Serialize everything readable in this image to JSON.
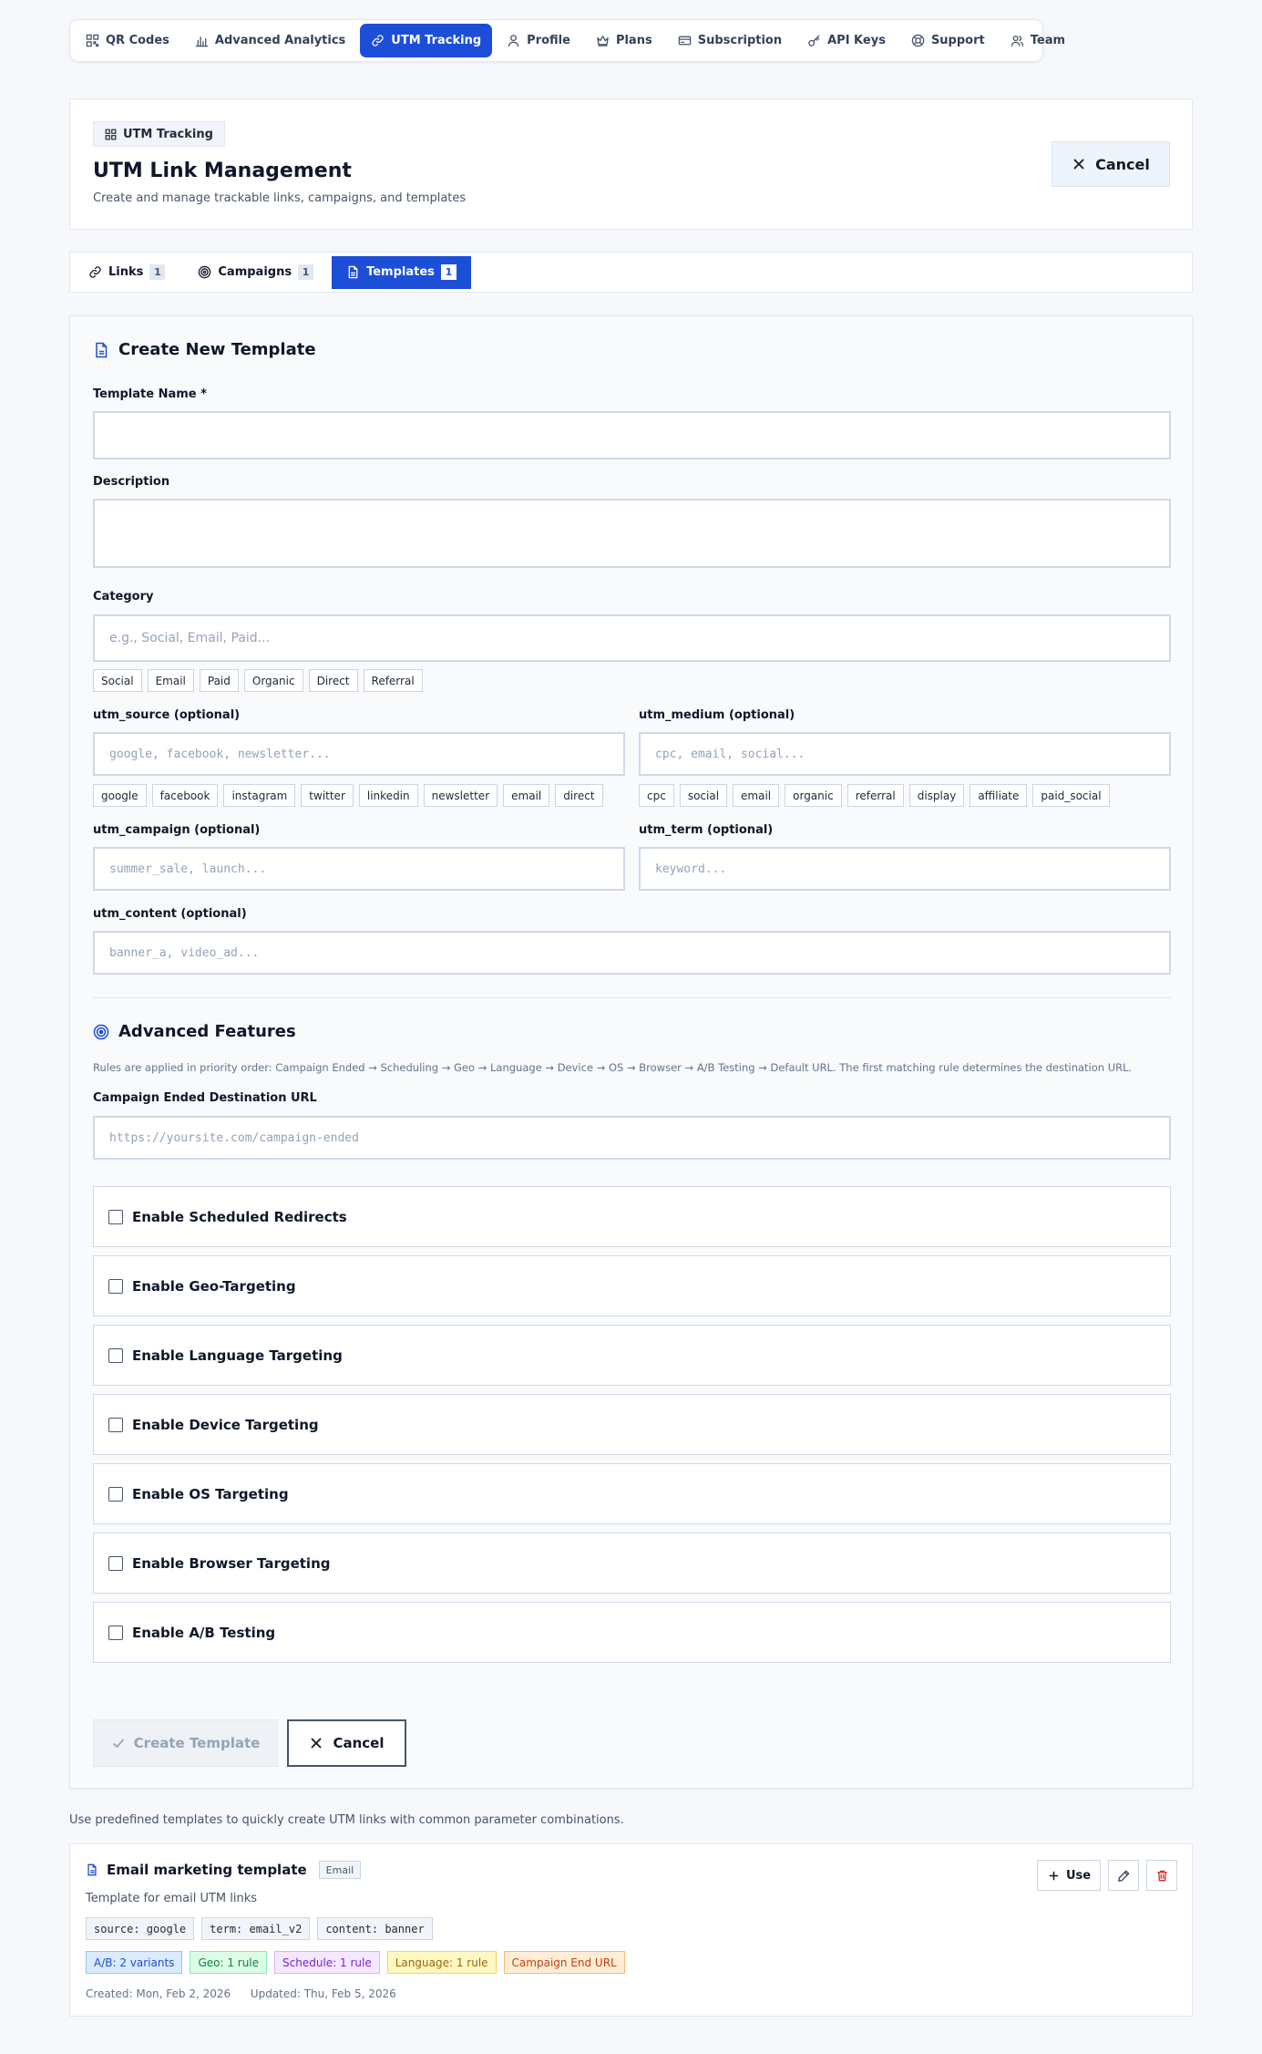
{
  "nav": [
    {
      "label": "QR Codes",
      "icon": "qr-code-icon",
      "active": false
    },
    {
      "label": "Advanced Analytics",
      "icon": "bar-chart-icon",
      "active": false
    },
    {
      "label": "UTM Tracking",
      "icon": "link-icon",
      "active": true
    },
    {
      "label": "Profile",
      "icon": "user-icon",
      "active": false
    },
    {
      "label": "Plans",
      "icon": "crown-icon",
      "active": false
    },
    {
      "label": "Subscription",
      "icon": "credit-card-icon",
      "active": false
    },
    {
      "label": "API Keys",
      "icon": "key-icon",
      "active": false
    },
    {
      "label": "Support",
      "icon": "lifebuoy-icon",
      "active": false
    },
    {
      "label": "Team",
      "icon": "users-icon",
      "active": false
    }
  ],
  "header": {
    "chip": "UTM Tracking",
    "title": "UTM Link Management",
    "subtitle": "Create and manage trackable links, campaigns, and templates",
    "cancel": "Cancel"
  },
  "tabs": [
    {
      "label": "Links",
      "count": "1",
      "icon": "link-icon",
      "active": false
    },
    {
      "label": "Campaigns",
      "count": "1",
      "icon": "target-icon",
      "active": false
    },
    {
      "label": "Templates",
      "count": "1",
      "icon": "file-icon",
      "active": true
    }
  ],
  "form": {
    "title": "Create New Template",
    "name_label": "Template Name *",
    "name_value": "",
    "description_label": "Description",
    "description_value": "",
    "category_label": "Category",
    "category_placeholder": "e.g., Social, Email, Paid...",
    "category_options": [
      "Social",
      "Email",
      "Paid",
      "Organic",
      "Direct",
      "Referral"
    ],
    "source_label": "utm_source (optional)",
    "source_placeholder": "google, facebook, newsletter...",
    "source_options": [
      "google",
      "facebook",
      "instagram",
      "twitter",
      "linkedin",
      "newsletter",
      "email",
      "direct"
    ],
    "medium_label": "utm_medium (optional)",
    "medium_placeholder": "cpc, email, social...",
    "medium_options": [
      "cpc",
      "social",
      "email",
      "organic",
      "referral",
      "display",
      "affiliate",
      "paid_social"
    ],
    "campaign_label": "utm_campaign (optional)",
    "campaign_placeholder": "summer_sale, launch...",
    "term_label": "utm_term (optional)",
    "term_placeholder": "keyword...",
    "content_label": "utm_content (optional)",
    "content_placeholder": "banner_a, video_ad...",
    "advanced_title": "Advanced Features",
    "advanced_note": "Rules are applied in priority order: Campaign Ended → Scheduling → Geo → Language → Device → OS → Browser → A/B Testing → Default URL. The first matching rule determines the destination URL.",
    "ended_label": "Campaign Ended Destination URL",
    "ended_placeholder": "https://yoursite.com/campaign-ended",
    "features": [
      {
        "label": "Enable Scheduled Redirects",
        "checked": false
      },
      {
        "label": "Enable Geo-Targeting",
        "checked": false
      },
      {
        "label": "Enable Language Targeting",
        "checked": false
      },
      {
        "label": "Enable Device Targeting",
        "checked": false
      },
      {
        "label": "Enable OS Targeting",
        "checked": false
      },
      {
        "label": "Enable Browser Targeting",
        "checked": false
      },
      {
        "label": "Enable A/B Testing",
        "checked": false
      }
    ],
    "create_button": "Create Template",
    "cancel_button": "Cancel"
  },
  "info_text": "Use predefined templates to quickly create UTM links with common parameter combinations.",
  "template": {
    "name": "Email marketing template",
    "category": "Email",
    "description": "Template for email UTM links",
    "params": [
      "source: google",
      "term: email_v2",
      "content: banner"
    ],
    "badges": [
      {
        "label": "A/B: 2 variants",
        "bg": "#dbeafe",
        "border": "#93c5fd",
        "color": "#1d4ed8"
      },
      {
        "label": "Geo: 1 rule",
        "bg": "#dcfce7",
        "border": "#86efac",
        "color": "#15803d"
      },
      {
        "label": "Schedule: 1 rule",
        "bg": "#f3e8ff",
        "border": "#d8b4fe",
        "color": "#7e22ce"
      },
      {
        "label": "Language: 1 rule",
        "bg": "#fef9c3",
        "border": "#fcd34d",
        "color": "#a16207"
      },
      {
        "label": "Campaign End URL",
        "bg": "#ffedd5",
        "border": "#fdba74",
        "color": "#c2410c"
      }
    ],
    "created": "Created: Mon, Feb 2, 2026",
    "updated": "Updated: Thu, Feb 5, 2026",
    "use_button": "Use"
  },
  "colors": {
    "accent": "#1d4ed8",
    "danger": "#dc2626"
  }
}
